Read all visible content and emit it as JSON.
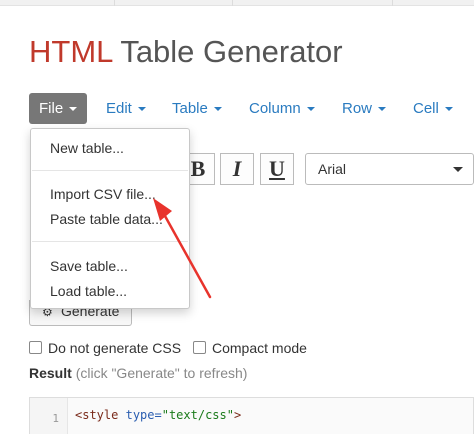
{
  "title": {
    "accent": "HTML",
    "rest": "Table Generator"
  },
  "menubar": {
    "file": "File",
    "edit": "Edit",
    "table": "Table",
    "column": "Column",
    "row": "Row",
    "cell": "Cell"
  },
  "file_menu": {
    "items": [
      "New table...",
      "Import CSV file...",
      "Paste table data...",
      "Save table...",
      "Load table..."
    ]
  },
  "toolbar": {
    "bold": "B",
    "italic": "I",
    "underline": "U",
    "font": "Arial"
  },
  "generate": {
    "label": "Generate"
  },
  "options": {
    "no_css": "Do not generate CSS",
    "compact": "Compact mode"
  },
  "result": {
    "label": "Result",
    "hint": "(click \"Generate\" to refresh)"
  },
  "code": {
    "line_no": "1",
    "tag_open": "<style",
    "attr": "type=",
    "value": "\"text/css\"",
    "tag_close": ">"
  },
  "colors": {
    "accent": "#c0392b",
    "link": "#2a7bc0",
    "active_menu": "#777777",
    "annotation_arrow": "#e8332c"
  },
  "icons": {
    "generate": "gear-icon",
    "annotation": "red-arrow-icon"
  }
}
